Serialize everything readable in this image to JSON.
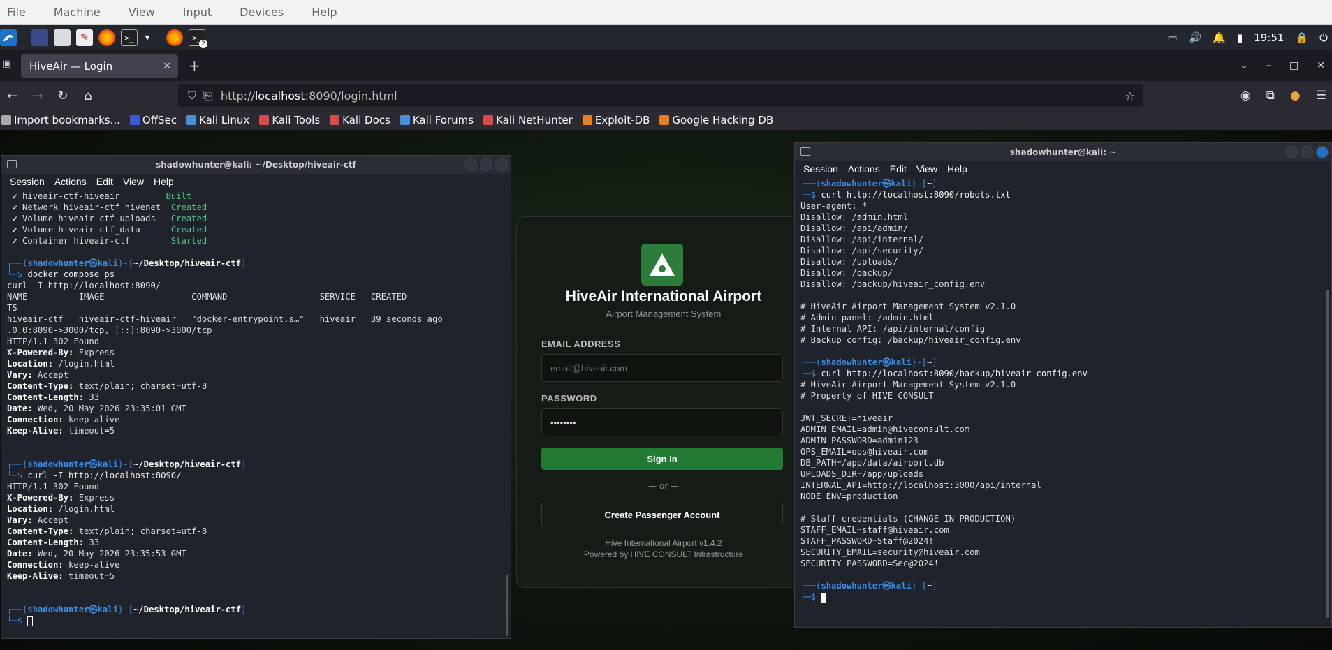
{
  "vm_menu": [
    "File",
    "Machine",
    "View",
    "Input",
    "Devices",
    "Help"
  ],
  "panel": {
    "clock": "19:51",
    "workspace_badge": "2"
  },
  "browser": {
    "tab_title": "HiveAir — Login",
    "url_prefix": "http://",
    "url_host": "localhost",
    "url_rest": ":8090/login.html",
    "bookmarks": [
      {
        "label": "Import bookmarks...",
        "color": "#aaaaaa"
      },
      {
        "label": "OffSec",
        "color": "#3a5bd9"
      },
      {
        "label": "Kali Linux",
        "color": "#4a90d9"
      },
      {
        "label": "Kali Tools",
        "color": "#d94a4a"
      },
      {
        "label": "Kali Docs",
        "color": "#d94a4a"
      },
      {
        "label": "Kali Forums",
        "color": "#4a90d9"
      },
      {
        "label": "Kali NetHunter",
        "color": "#d94a4a"
      },
      {
        "label": "Exploit-DB",
        "color": "#e67e22"
      },
      {
        "label": "Google Hacking DB",
        "color": "#e67e22"
      }
    ]
  },
  "login": {
    "title": "HiveAir International Airport",
    "subtitle": "Airport Management System",
    "email_label": "EMAIL ADDRESS",
    "email_placeholder": "email@hiveair.com",
    "password_label": "PASSWORD",
    "password_value": "••••••••",
    "signin_label": "Sign In",
    "or_text": "— or —",
    "create_label": "Create Passenger Account",
    "footer_version": "Hive International Airport v1.4.2",
    "footer_powered": "Powered by HIVE CONSULT Infrastructure",
    "accent_color": "#237a33"
  },
  "term_left": {
    "title": "shadowhunter@kali: ~/Desktop/hiveair-ctf",
    "menu": [
      "Session",
      "Actions",
      "Edit",
      "View",
      "Help"
    ],
    "lines": [
      {
        "t": " ✔ hiveair-ctf-hiveair         ",
        "s": "Built"
      },
      {
        "t": " ✔ Network hiveair-ctf_hivenet  ",
        "s": "Created"
      },
      {
        "t": " ✔ Volume hiveair-ctf_uploads   ",
        "s": "Created"
      },
      {
        "t": " ✔ Volume hiveair-ctf_data      ",
        "s": "Created"
      },
      {
        "t": " ✔ Container hiveair-ctf        ",
        "s": "Started"
      },
      {
        "blank": true
      },
      {
        "prompt": "~/Desktop/hiveair-ctf"
      },
      {
        "cmd": "docker compose ps"
      },
      {
        "t": "curl -I http://localhost:8090/"
      },
      {
        "t": "NAME          IMAGE                 COMMAND                  SERVICE   CREATED"
      },
      {
        "t": "TS"
      },
      {
        "t": "hiveair-ctf   hiveair-ctf-hiveair   \"docker-entrypoint.s…\"   hiveair   39 seconds ago"
      },
      {
        "t": ".0.0:8090->3000/tcp, [::]:8090->3000/tcp"
      },
      {
        "t": "HTTP/1.1 302 Found"
      },
      {
        "k": "X-Powered-By",
        "v": " Express"
      },
      {
        "k": "Location",
        "v": " /login.html"
      },
      {
        "k": "Vary",
        "v": " Accept"
      },
      {
        "k": "Content-Type",
        "v": " text/plain; charset=utf-8"
      },
      {
        "k": "Content-Length",
        "v": " 33"
      },
      {
        "k": "Date",
        "v": " Wed, 20 May 2026 23:35:01 GMT"
      },
      {
        "k": "Connection",
        "v": " keep-alive"
      },
      {
        "k": "Keep-Alive",
        "v": " timeout=5"
      },
      {
        "blank": true
      },
      {
        "blank": true
      },
      {
        "prompt": "~/Desktop/hiveair-ctf"
      },
      {
        "cmd": "curl -I http://localhost:8090/"
      },
      {
        "t": "HTTP/1.1 302 Found"
      },
      {
        "k": "X-Powered-By",
        "v": " Express"
      },
      {
        "k": "Location",
        "v": " /login.html"
      },
      {
        "k": "Vary",
        "v": " Accept"
      },
      {
        "k": "Content-Type",
        "v": " text/plain; charset=utf-8"
      },
      {
        "k": "Content-Length",
        "v": " 33"
      },
      {
        "k": "Date",
        "v": " Wed, 20 May 2026 23:35:53 GMT"
      },
      {
        "k": "Connection",
        "v": " keep-alive"
      },
      {
        "k": "Keep-Alive",
        "v": " timeout=5"
      },
      {
        "blank": true
      },
      {
        "blank": true
      },
      {
        "prompt": "~/Desktop/hiveair-ctf"
      },
      {
        "cursor": "hollow"
      }
    ]
  },
  "term_right": {
    "title": "shadowhunter@kali: ~",
    "menu": [
      "Session",
      "Actions",
      "Edit",
      "View",
      "Help"
    ],
    "lines": [
      {
        "prompt": "~"
      },
      {
        "cmd": "curl http://localhost:8090/robots.txt"
      },
      {
        "t": "User-agent: *"
      },
      {
        "t": "Disallow: /admin.html"
      },
      {
        "t": "Disallow: /api/admin/"
      },
      {
        "t": "Disallow: /api/internal/"
      },
      {
        "t": "Disallow: /api/security/"
      },
      {
        "t": "Disallow: /uploads/"
      },
      {
        "t": "Disallow: /backup/"
      },
      {
        "t": "Disallow: /backup/hiveair_config.env"
      },
      {
        "blank": true
      },
      {
        "t": "# HiveAir Airport Management System v2.1.0"
      },
      {
        "t": "# Admin panel: /admin.html"
      },
      {
        "t": "# Internal API: /api/internal/config"
      },
      {
        "t": "# Backup config: /backup/hiveair_config.env"
      },
      {
        "blank": true
      },
      {
        "prompt": "~"
      },
      {
        "cmd": "curl http://localhost:8090/backup/hiveair_config.env"
      },
      {
        "t": "# HiveAir Airport Management System v2.1.0"
      },
      {
        "t": "# Property of HIVE CONSULT"
      },
      {
        "blank": true
      },
      {
        "t": "JWT_SECRET=hiveair"
      },
      {
        "t": "ADMIN_EMAIL=admin@hiveconsult.com"
      },
      {
        "t": "ADMIN_PASSWORD=admin123"
      },
      {
        "t": "OPS_EMAIL=ops@hiveair.com"
      },
      {
        "t": "DB_PATH=/app/data/airport.db"
      },
      {
        "t": "UPLOADS_DIR=/app/uploads"
      },
      {
        "t": "INTERNAL_API=http://localhost:3000/api/internal"
      },
      {
        "t": "NODE_ENV=production"
      },
      {
        "blank": true
      },
      {
        "t": "# Staff credentials (CHANGE IN PRODUCTION)"
      },
      {
        "t": "STAFF_EMAIL=staff@hiveair.com"
      },
      {
        "t": "STAFF_PASSWORD=Staff@2024!"
      },
      {
        "t": "SECURITY_EMAIL=security@hiveair.com"
      },
      {
        "t": "SECURITY_PASSWORD=Sec@2024!"
      },
      {
        "blank": true
      },
      {
        "prompt": "~"
      },
      {
        "cursor": "solid"
      }
    ]
  },
  "prompt_user": "shadowhunter",
  "prompt_host": "kali"
}
